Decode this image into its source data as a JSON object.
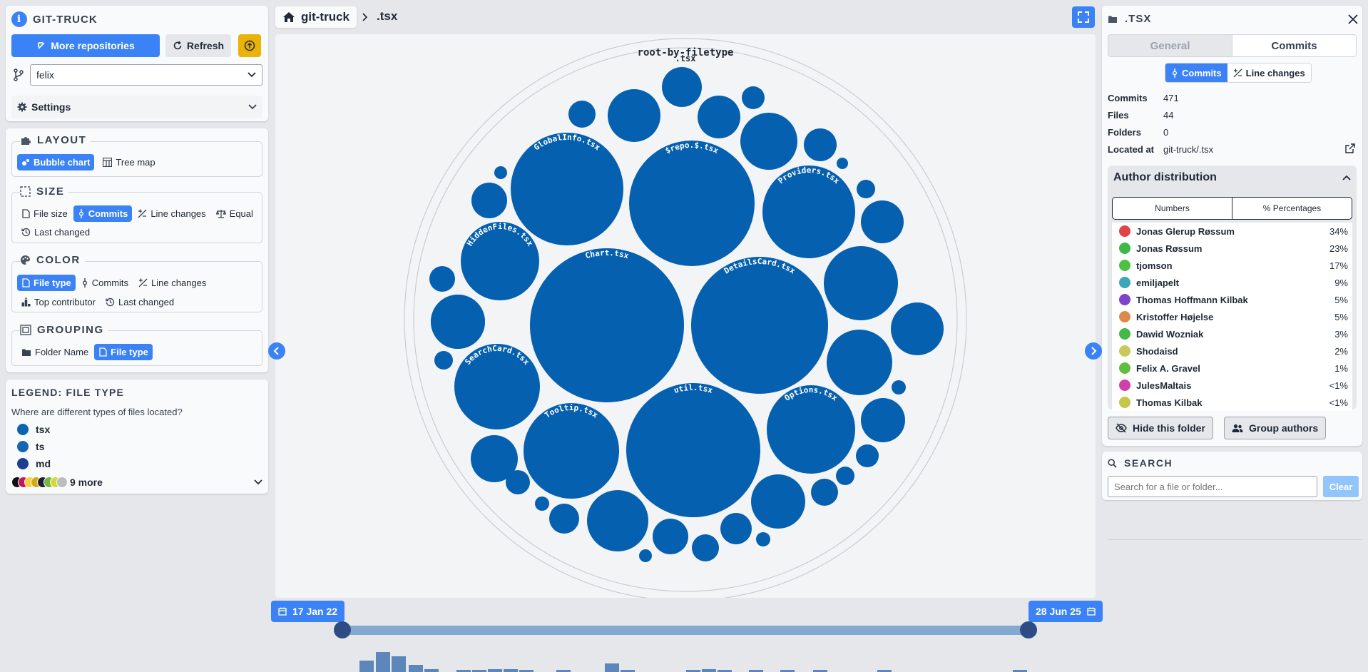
{
  "app": {
    "title": "GIT-TRUCK",
    "more_repos_label": "More repositories",
    "refresh_label": "Refresh",
    "branch": "felix",
    "settings_label": "Settings"
  },
  "breadcrumb": {
    "repo": "git-truck",
    "current": ".tsx"
  },
  "layout": {
    "title": "LAYOUT",
    "options": [
      "Bubble chart",
      "Tree map"
    ],
    "active": "Bubble chart"
  },
  "size": {
    "title": "SIZE",
    "options": [
      "File size",
      "Commits",
      "Line changes",
      "Equal",
      "Last changed"
    ],
    "active": "Commits"
  },
  "color": {
    "title": "COLOR",
    "options": [
      "File type",
      "Commits",
      "Line changes",
      "Top contributor",
      "Last changed"
    ],
    "active": "File type"
  },
  "grouping": {
    "title": "GROUPING",
    "options": [
      "Folder Name",
      "File type"
    ],
    "active": "File type"
  },
  "legend": {
    "title": "LEGEND: FILE TYPE",
    "question": "Where are different types of files located?",
    "items": [
      {
        "label": "tsx",
        "color": "#0b64b0"
      },
      {
        "label": "ts",
        "color": "#1565b3"
      },
      {
        "label": "md",
        "color": "#1d3f91"
      }
    ],
    "more_label": "9 more",
    "more_colors": [
      "#111111",
      "#c2185b",
      "#f4d03f",
      "#d4ac0d",
      "#1b1f3b",
      "#7cb342",
      "#cddc39",
      "#bdbdbd"
    ]
  },
  "chart": {
    "root_label": "root-by-filetype",
    "group_label": ".tsx",
    "bubble_color": "#0560b0",
    "labeled_bubbles": [
      "GlobalInfo.tsx",
      "$repo.$.tsx",
      "Providers.tsx",
      "HiddenFiles.tsx",
      "Chart.tsx",
      "DetailsCard.tsx",
      "SearchCard.tsx",
      "Tooltip.tsx",
      "util.tsx",
      "Options.tsx"
    ]
  },
  "timeline": {
    "start": "17 Jan 22",
    "end": "28 Jun 25"
  },
  "details": {
    "title": ".TSX",
    "tabs": [
      "General",
      "Commits"
    ],
    "active_tab": "Commits",
    "toggle": [
      "Commits",
      "Line changes"
    ],
    "toggle_active": "Commits",
    "info": [
      {
        "k": "Commits",
        "v": "471"
      },
      {
        "k": "Files",
        "v": "44"
      },
      {
        "k": "Folders",
        "v": "0"
      },
      {
        "k": "Located at",
        "v": "git-truck/.tsx"
      }
    ],
    "author_title": "Author distribution",
    "author_modes": [
      "Numbers",
      "% Percentages"
    ],
    "authors": [
      {
        "name": "Jonas Glerup Røssum",
        "pct": "34%",
        "color": "#e04444"
      },
      {
        "name": "Jonas Røssum",
        "pct": "23%",
        "color": "#3fb84a"
      },
      {
        "name": "tjomson",
        "pct": "17%",
        "color": "#4cc242"
      },
      {
        "name": "emiljapelt",
        "pct": "9%",
        "color": "#3aa6b9"
      },
      {
        "name": "Thomas Hoffmann Kilbak",
        "pct": "5%",
        "color": "#7e44c9"
      },
      {
        "name": "Kristoffer Højelse",
        "pct": "5%",
        "color": "#d98a4a"
      },
      {
        "name": "Dawid Wozniak",
        "pct": "3%",
        "color": "#43b94a"
      },
      {
        "name": "Shodaisd",
        "pct": "2%",
        "color": "#c9c85a"
      },
      {
        "name": "Felix A. Gravel",
        "pct": "1%",
        "color": "#5fbe3f"
      },
      {
        "name": "JulesMaltais",
        "pct": "<1%",
        "color": "#d13fa8"
      },
      {
        "name": "Thomas Kilbak",
        "pct": "<1%",
        "color": "#c6c649"
      }
    ],
    "hide_label": "Hide this folder",
    "group_label": "Group authors"
  },
  "search": {
    "title": "SEARCH",
    "placeholder": "Search for a file or folder...",
    "clear_label": "Clear"
  }
}
